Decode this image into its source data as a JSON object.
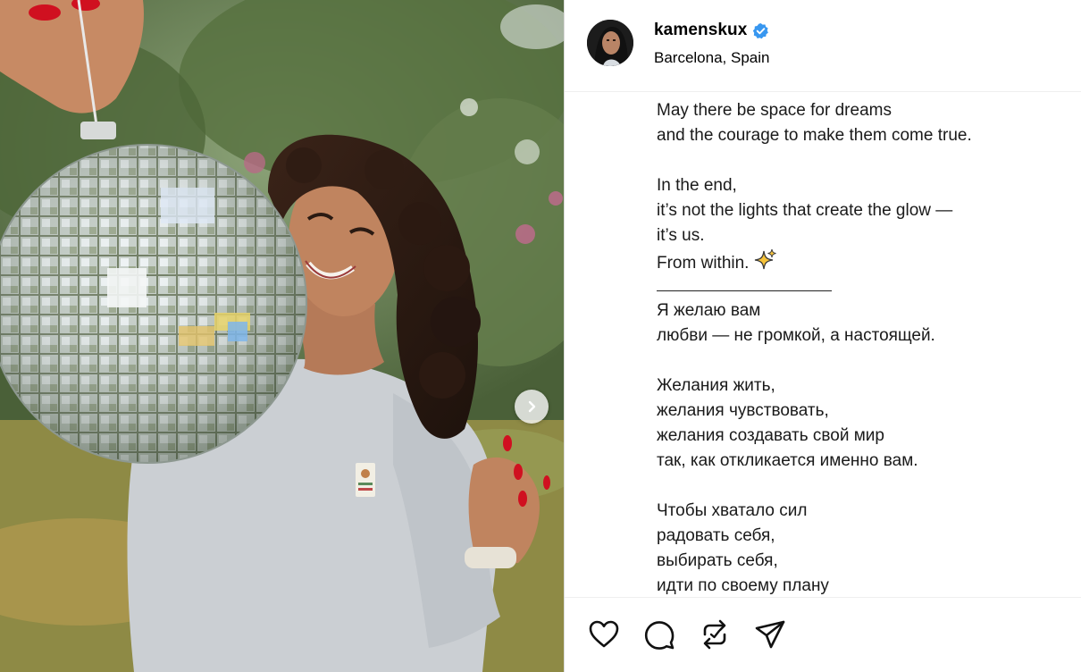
{
  "post": {
    "username": "kamenskux",
    "location": "Barcelona, Spain",
    "verified": true
  },
  "caption": {
    "lines": [
      "May there be space for dreams",
      "and the courage to make them come true.",
      "",
      "In the end,",
      "it’s not the lights that create the glow —",
      "it’s us.",
      "From within.",
      "———————————",
      "Я желаю вам",
      "любви — не громкой, а настоящей.",
      "",
      "Желания жить,",
      "желания чувствовать,",
      "желания создавать свой мир",
      "так, как откликается именно вам.",
      "",
      "Чтобы хватало сил",
      "радовать себя,",
      "выбирать себя,",
      "идти по своему плану"
    ],
    "sparkle_line_index": 6
  },
  "actions": [
    "heart-icon",
    "comment-icon",
    "repost-icon",
    "share-icon"
  ],
  "colors": {
    "verified": "#3897f0",
    "nail_polish": "#d01020",
    "hoodie": "#c9ccd0"
  }
}
